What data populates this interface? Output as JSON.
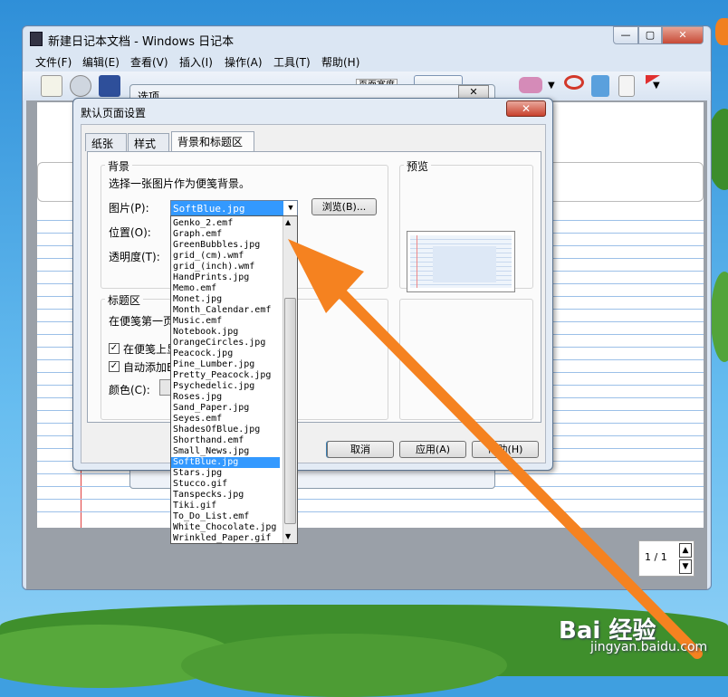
{
  "window": {
    "title": "新建日记本文档 - Windows 日记本",
    "buttons": {
      "minimize": "—",
      "maximize": "▢",
      "close": "✕"
    }
  },
  "menubar": {
    "items": [
      "文件(F)",
      "编辑(E)",
      "查看(V)",
      "插入(I)",
      "操作(A)",
      "工具(T)",
      "帮助(H)"
    ]
  },
  "toolbar": {
    "zoom_value": "页面宽度"
  },
  "options_dialog": {
    "title": "选项",
    "close": "✕"
  },
  "dialog": {
    "title": "默认页面设置",
    "close": "✕",
    "tabs": [
      "纸张",
      "样式",
      "背景和标题区"
    ],
    "background_group": {
      "label": "背景",
      "instruction": "选择一张图片作为便笺背景。",
      "picture_label": "图片(P):",
      "picture_value": "SoftBlue.jpg",
      "browse_button": "浏览(B)...",
      "position_label": "位置(O):",
      "transparency_label": "透明度(T):"
    },
    "preview_label": "预览",
    "title_group": {
      "label": "标题区",
      "text": "在便笺第一页",
      "checkbox1": "在便笺上显",
      "checkbox2": "自动添加B",
      "color_label": "颜色(C):"
    },
    "buttons": {
      "ok": "",
      "cancel": "取消",
      "apply": "应用(A)",
      "help": "帮助(H)"
    }
  },
  "dropdown_items": [
    "Genko_2.emf",
    "Graph.emf",
    "GreenBubbles.jpg",
    "grid_(cm).wmf",
    "grid_(inch).wmf",
    "HandPrints.jpg",
    "Memo.emf",
    "Monet.jpg",
    "Month_Calendar.emf",
    "Music.emf",
    "Notebook.jpg",
    "OrangeCircles.jpg",
    "Peacock.jpg",
    "Pine_Lumber.jpg",
    "Pretty_Peacock.jpg",
    "Psychedelic.jpg",
    "Roses.jpg",
    "Sand_Paper.jpg",
    "Seyes.emf",
    "ShadesOfBlue.jpg",
    "Shorthand.emf",
    "Small_News.jpg",
    "SoftBlue.jpg",
    "Stars.jpg",
    "Stucco.gif",
    "Tanspecks.jpg",
    "Tiki.gif",
    "To_Do_List.emf",
    "White_Chocolate.jpg",
    "Wrinkled_Paper.gif"
  ],
  "dropdown_selected_index": 22,
  "page_counter": {
    "text": "1 / 1"
  },
  "watermark": {
    "brand": "Bai 经验",
    "url": "jingyan.baidu.com"
  },
  "colors": {
    "accent": "#3399ff",
    "arrow": "#f58220",
    "dialog_close": "#c8412d"
  }
}
